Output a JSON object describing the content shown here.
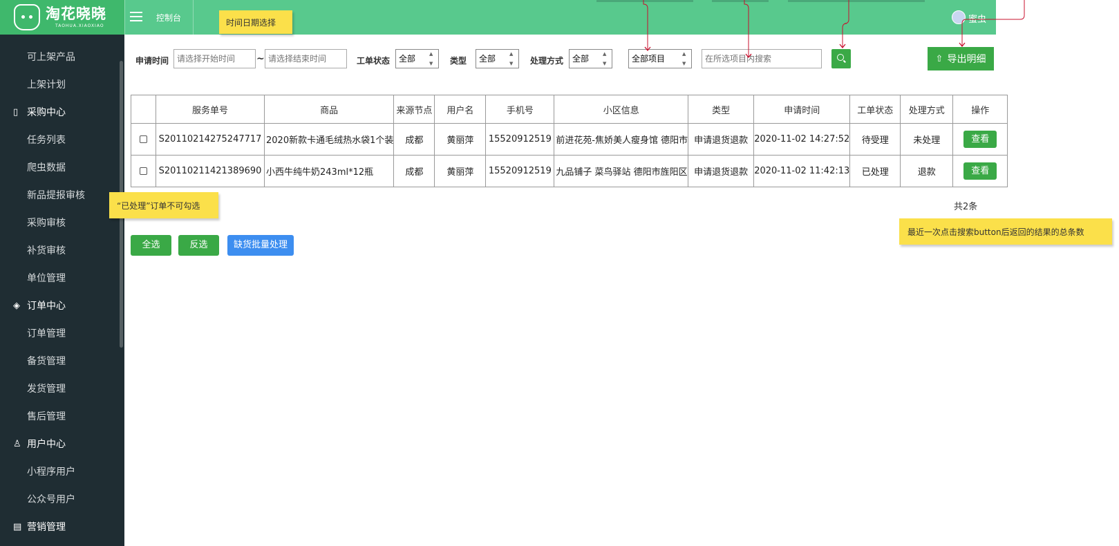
{
  "brand": {
    "name_cn": "淘花晓晓",
    "name_en": "TAOHUA.XIAOXIAO"
  },
  "header": {
    "console": "控制台",
    "username": "蜜虫"
  },
  "sidebar": {
    "items": [
      {
        "label": "可上架产品",
        "type": "item"
      },
      {
        "label": "上架计划",
        "type": "item"
      },
      {
        "label": "采购中心",
        "type": "group",
        "icon": "clipboard-icon"
      },
      {
        "label": "任务列表",
        "type": "item"
      },
      {
        "label": "爬虫数据",
        "type": "item"
      },
      {
        "label": "新品提报审核",
        "type": "item"
      },
      {
        "label": "采购审核",
        "type": "item"
      },
      {
        "label": "补货审核",
        "type": "item"
      },
      {
        "label": "单位管理",
        "type": "item"
      },
      {
        "label": "订单中心",
        "type": "group",
        "icon": "layers-icon"
      },
      {
        "label": "订单管理",
        "type": "item"
      },
      {
        "label": "备货管理",
        "type": "item"
      },
      {
        "label": "发货管理",
        "type": "item"
      },
      {
        "label": "售后管理",
        "type": "item"
      },
      {
        "label": "用户中心",
        "type": "group",
        "icon": "user-icon"
      },
      {
        "label": "小程序用户",
        "type": "item"
      },
      {
        "label": "公众号用户",
        "type": "item"
      },
      {
        "label": "营销管理",
        "type": "group",
        "icon": "calendar-icon"
      }
    ]
  },
  "filters": {
    "apply_time_label": "申请时间",
    "start_placeholder": "请选择开始时间",
    "range_sep": "~",
    "end_placeholder": "请选择结束时间",
    "status_label": "工单状态",
    "status_value": "全部",
    "type_label": "类型",
    "type_value": "全部",
    "method_label": "处理方式",
    "method_value": "全部",
    "scope_value": "全部项目",
    "search_placeholder": "在所选项目内搜索",
    "export_label": "导出明细"
  },
  "table": {
    "columns": [
      "",
      "服务单号",
      "商品",
      "来源节点",
      "用户名",
      "手机号",
      "小区信息",
      "类型",
      "申请时间",
      "工单状态",
      "处理方式",
      "操作"
    ],
    "rows": [
      {
        "checkbox": true,
        "service_no": "S20110214275247717",
        "product": "2020新款卡通毛绒热水袋1个装",
        "source": "成都",
        "user": "黄丽萍",
        "phone": "15520912519",
        "community": "前进花苑-焦娇美人瘦身馆 德阳市",
        "type": "申请退货退款",
        "time": "2020-11-02 14:27:52",
        "status": "待受理",
        "method": "未处理",
        "action": "查看"
      },
      {
        "checkbox": true,
        "service_no": "S20110211421389690",
        "product": "小西牛纯牛奶243ml*12瓶",
        "source": "成都",
        "user": "黄丽萍",
        "phone": "15520912519",
        "community": "九品铺子 菜鸟驿站 德阳市旌阳区",
        "type": "申请退货退款",
        "time": "2020-11-02 11:42:13",
        "status": "已处理",
        "method": "退款",
        "action": "查看"
      }
    ]
  },
  "total": "共2条",
  "actions": {
    "select_all": "全选",
    "invert": "反选",
    "batch": "缺货批量处理"
  },
  "notes": {
    "date": "时间日期选择",
    "processed": "“已处理”订单不可勾选",
    "count": "最近一次点击搜索button后返回的结果的总条数"
  },
  "colors": {
    "brand_green": "#3fb86c",
    "header_green": "#58c98d",
    "button_green": "#3aa946",
    "button_blue": "#3d8ef0",
    "sidebar": "#1f2d33",
    "note_yellow": "#fbe04a",
    "annotation_red": "#c8102e"
  }
}
